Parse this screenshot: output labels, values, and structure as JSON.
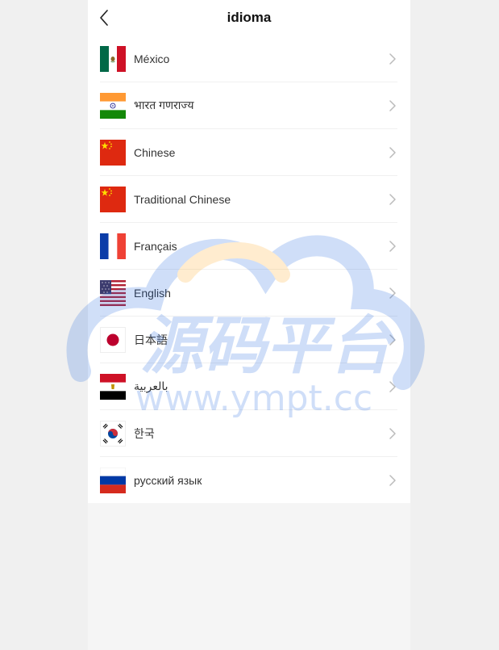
{
  "header": {
    "title": "idioma",
    "back_icon": "chevron-left-icon"
  },
  "languages": [
    {
      "label": "México",
      "flag": "mexico-flag-icon"
    },
    {
      "label": "भारत गणराज्य",
      "flag": "india-flag-icon"
    },
    {
      "label": "Chinese",
      "flag": "china-flag-icon"
    },
    {
      "label": "Traditional Chinese",
      "flag": "china-flag-icon"
    },
    {
      "label": "Français",
      "flag": "france-flag-icon"
    },
    {
      "label": "English",
      "flag": "usa-flag-icon"
    },
    {
      "label": "日本語",
      "flag": "japan-flag-icon"
    },
    {
      "label": "بالعربية",
      "flag": "egypt-flag-icon"
    },
    {
      "label": "한국",
      "flag": "korea-flag-icon"
    },
    {
      "label": "русский язык",
      "flag": "russia-flag-icon"
    }
  ],
  "watermark": {
    "text_cn": "源码平台",
    "text_url": "www.ympt.cc"
  },
  "colors": {
    "page_bg": "#f5f5f5",
    "list_bg": "#ffffff",
    "text": "#333333",
    "chevron": "#bbbbbb"
  }
}
